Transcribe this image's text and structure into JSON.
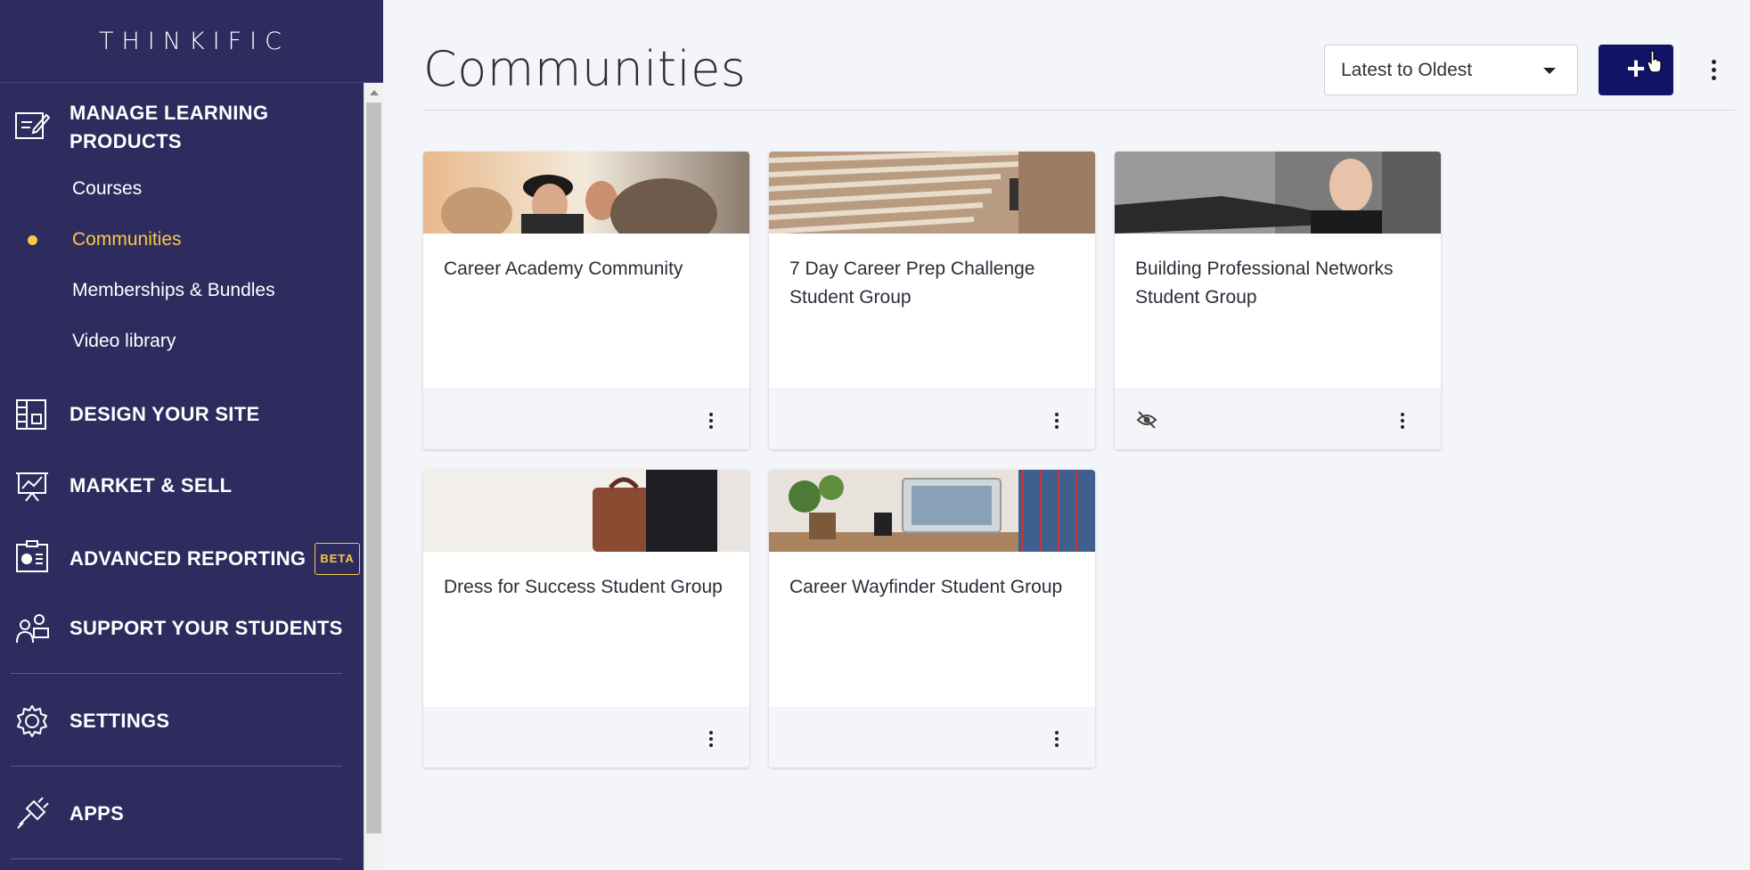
{
  "sidebar": {
    "logo": "THINKIFIC",
    "sections": {
      "manage": {
        "line1": "MANAGE LEARNING",
        "line2": "PRODUCTS"
      },
      "design": "DESIGN YOUR SITE",
      "market": "MARKET & SELL",
      "reporting": "ADVANCED REPORTING",
      "reporting_badge": "BETA",
      "support": "SUPPORT YOUR STUDENTS",
      "settings": "SETTINGS",
      "apps": "APPS"
    },
    "sub_items": {
      "courses": "Courses",
      "communities": "Communities",
      "memberships": "Memberships & Bundles",
      "video_library": "Video library"
    }
  },
  "header": {
    "title": "Communities",
    "sort": {
      "selected": "Latest to Oldest"
    },
    "add_label": "+"
  },
  "communities": [
    {
      "title": "Career Academy Community",
      "hidden": false
    },
    {
      "title": "7 Day Career Prep Challenge Student Group",
      "hidden": false
    },
    {
      "title": "Building Professional Networks Student Group",
      "hidden": true
    },
    {
      "title": "Dress for Success Student Group",
      "hidden": false
    },
    {
      "title": "Career Wayfinder Student Group",
      "hidden": false
    }
  ],
  "colors": {
    "sidebar_bg": "#2e2b5f",
    "accent_yellow": "#f7c948",
    "primary_button": "#111466"
  }
}
